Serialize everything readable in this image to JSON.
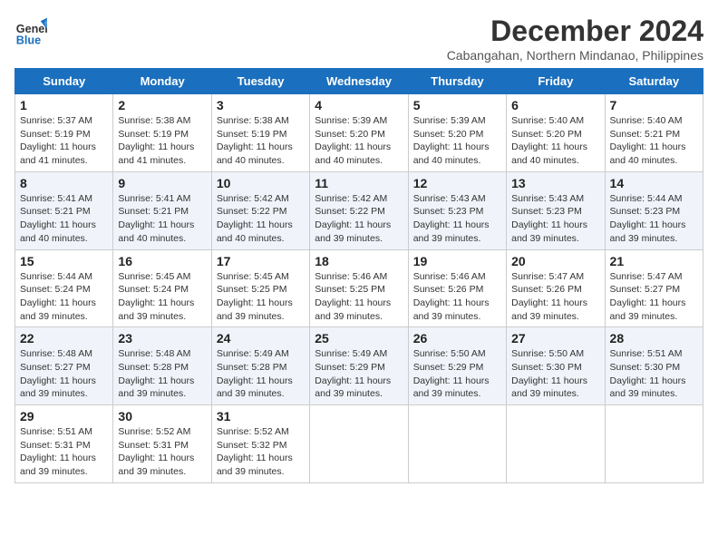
{
  "header": {
    "logo_line1": "General",
    "logo_line2": "Blue",
    "month": "December 2024",
    "location": "Cabangahan, Northern Mindanao, Philippines"
  },
  "days_of_week": [
    "Sunday",
    "Monday",
    "Tuesday",
    "Wednesday",
    "Thursday",
    "Friday",
    "Saturday"
  ],
  "weeks": [
    [
      {
        "day": 1,
        "sunrise": "5:37 AM",
        "sunset": "5:19 PM",
        "daylight": "11 hours and 41 minutes."
      },
      {
        "day": 2,
        "sunrise": "5:38 AM",
        "sunset": "5:19 PM",
        "daylight": "11 hours and 41 minutes."
      },
      {
        "day": 3,
        "sunrise": "5:38 AM",
        "sunset": "5:19 PM",
        "daylight": "11 hours and 40 minutes."
      },
      {
        "day": 4,
        "sunrise": "5:39 AM",
        "sunset": "5:20 PM",
        "daylight": "11 hours and 40 minutes."
      },
      {
        "day": 5,
        "sunrise": "5:39 AM",
        "sunset": "5:20 PM",
        "daylight": "11 hours and 40 minutes."
      },
      {
        "day": 6,
        "sunrise": "5:40 AM",
        "sunset": "5:20 PM",
        "daylight": "11 hours and 40 minutes."
      },
      {
        "day": 7,
        "sunrise": "5:40 AM",
        "sunset": "5:21 PM",
        "daylight": "11 hours and 40 minutes."
      }
    ],
    [
      {
        "day": 8,
        "sunrise": "5:41 AM",
        "sunset": "5:21 PM",
        "daylight": "11 hours and 40 minutes."
      },
      {
        "day": 9,
        "sunrise": "5:41 AM",
        "sunset": "5:21 PM",
        "daylight": "11 hours and 40 minutes."
      },
      {
        "day": 10,
        "sunrise": "5:42 AM",
        "sunset": "5:22 PM",
        "daylight": "11 hours and 40 minutes."
      },
      {
        "day": 11,
        "sunrise": "5:42 AM",
        "sunset": "5:22 PM",
        "daylight": "11 hours and 39 minutes."
      },
      {
        "day": 12,
        "sunrise": "5:43 AM",
        "sunset": "5:23 PM",
        "daylight": "11 hours and 39 minutes."
      },
      {
        "day": 13,
        "sunrise": "5:43 AM",
        "sunset": "5:23 PM",
        "daylight": "11 hours and 39 minutes."
      },
      {
        "day": 14,
        "sunrise": "5:44 AM",
        "sunset": "5:23 PM",
        "daylight": "11 hours and 39 minutes."
      }
    ],
    [
      {
        "day": 15,
        "sunrise": "5:44 AM",
        "sunset": "5:24 PM",
        "daylight": "11 hours and 39 minutes."
      },
      {
        "day": 16,
        "sunrise": "5:45 AM",
        "sunset": "5:24 PM",
        "daylight": "11 hours and 39 minutes."
      },
      {
        "day": 17,
        "sunrise": "5:45 AM",
        "sunset": "5:25 PM",
        "daylight": "11 hours and 39 minutes."
      },
      {
        "day": 18,
        "sunrise": "5:46 AM",
        "sunset": "5:25 PM",
        "daylight": "11 hours and 39 minutes."
      },
      {
        "day": 19,
        "sunrise": "5:46 AM",
        "sunset": "5:26 PM",
        "daylight": "11 hours and 39 minutes."
      },
      {
        "day": 20,
        "sunrise": "5:47 AM",
        "sunset": "5:26 PM",
        "daylight": "11 hours and 39 minutes."
      },
      {
        "day": 21,
        "sunrise": "5:47 AM",
        "sunset": "5:27 PM",
        "daylight": "11 hours and 39 minutes."
      }
    ],
    [
      {
        "day": 22,
        "sunrise": "5:48 AM",
        "sunset": "5:27 PM",
        "daylight": "11 hours and 39 minutes."
      },
      {
        "day": 23,
        "sunrise": "5:48 AM",
        "sunset": "5:28 PM",
        "daylight": "11 hours and 39 minutes."
      },
      {
        "day": 24,
        "sunrise": "5:49 AM",
        "sunset": "5:28 PM",
        "daylight": "11 hours and 39 minutes."
      },
      {
        "day": 25,
        "sunrise": "5:49 AM",
        "sunset": "5:29 PM",
        "daylight": "11 hours and 39 minutes."
      },
      {
        "day": 26,
        "sunrise": "5:50 AM",
        "sunset": "5:29 PM",
        "daylight": "11 hours and 39 minutes."
      },
      {
        "day": 27,
        "sunrise": "5:50 AM",
        "sunset": "5:30 PM",
        "daylight": "11 hours and 39 minutes."
      },
      {
        "day": 28,
        "sunrise": "5:51 AM",
        "sunset": "5:30 PM",
        "daylight": "11 hours and 39 minutes."
      }
    ],
    [
      {
        "day": 29,
        "sunrise": "5:51 AM",
        "sunset": "5:31 PM",
        "daylight": "11 hours and 39 minutes."
      },
      {
        "day": 30,
        "sunrise": "5:52 AM",
        "sunset": "5:31 PM",
        "daylight": "11 hours and 39 minutes."
      },
      {
        "day": 31,
        "sunrise": "5:52 AM",
        "sunset": "5:32 PM",
        "daylight": "11 hours and 39 minutes."
      },
      null,
      null,
      null,
      null
    ]
  ]
}
